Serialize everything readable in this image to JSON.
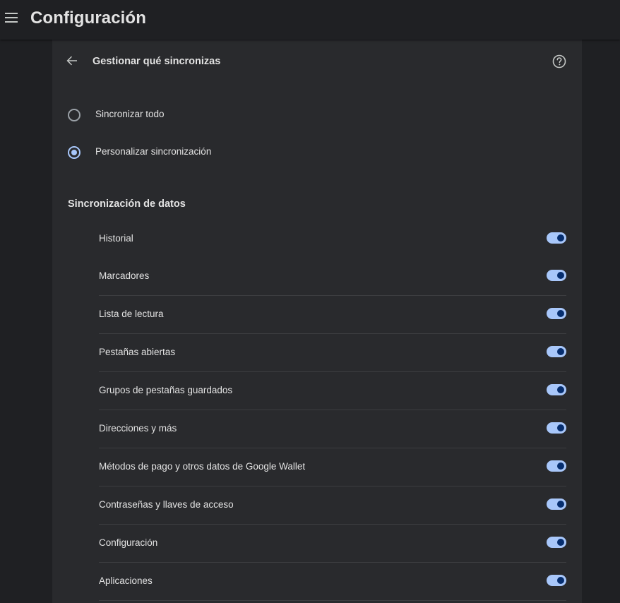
{
  "header": {
    "title": "Configuración",
    "menu_icon": "hamburger-menu-icon"
  },
  "subpage": {
    "title": "Gestionar qué sincronizas",
    "back_icon": "arrow-back-icon",
    "help_icon": "help-circle-icon"
  },
  "sync_mode": {
    "options": [
      {
        "label": "Sincronizar todo",
        "checked": false
      },
      {
        "label": "Personalizar sincronización",
        "checked": true
      }
    ]
  },
  "data_section": {
    "title": "Sincronización de datos",
    "items": [
      {
        "label": "Historial",
        "enabled": true
      },
      {
        "label": "Marcadores",
        "enabled": true
      },
      {
        "label": "Lista de lectura",
        "enabled": true
      },
      {
        "label": "Pestañas abiertas",
        "enabled": true
      },
      {
        "label": "Grupos de pestañas guardados",
        "enabled": true
      },
      {
        "label": "Direcciones y más",
        "enabled": true
      },
      {
        "label": "Métodos de pago y otros datos de Google Wallet",
        "enabled": true
      },
      {
        "label": "Contraseñas y llaves de acceso",
        "enabled": true
      },
      {
        "label": "Configuración",
        "enabled": true
      },
      {
        "label": "Aplicaciones",
        "enabled": true
      }
    ]
  },
  "colors": {
    "background": "#1f2023",
    "card": "#292a2d",
    "accent": "#a8c7fa",
    "toggle_knob": "#062e6f",
    "text": "#e3e3e3"
  }
}
